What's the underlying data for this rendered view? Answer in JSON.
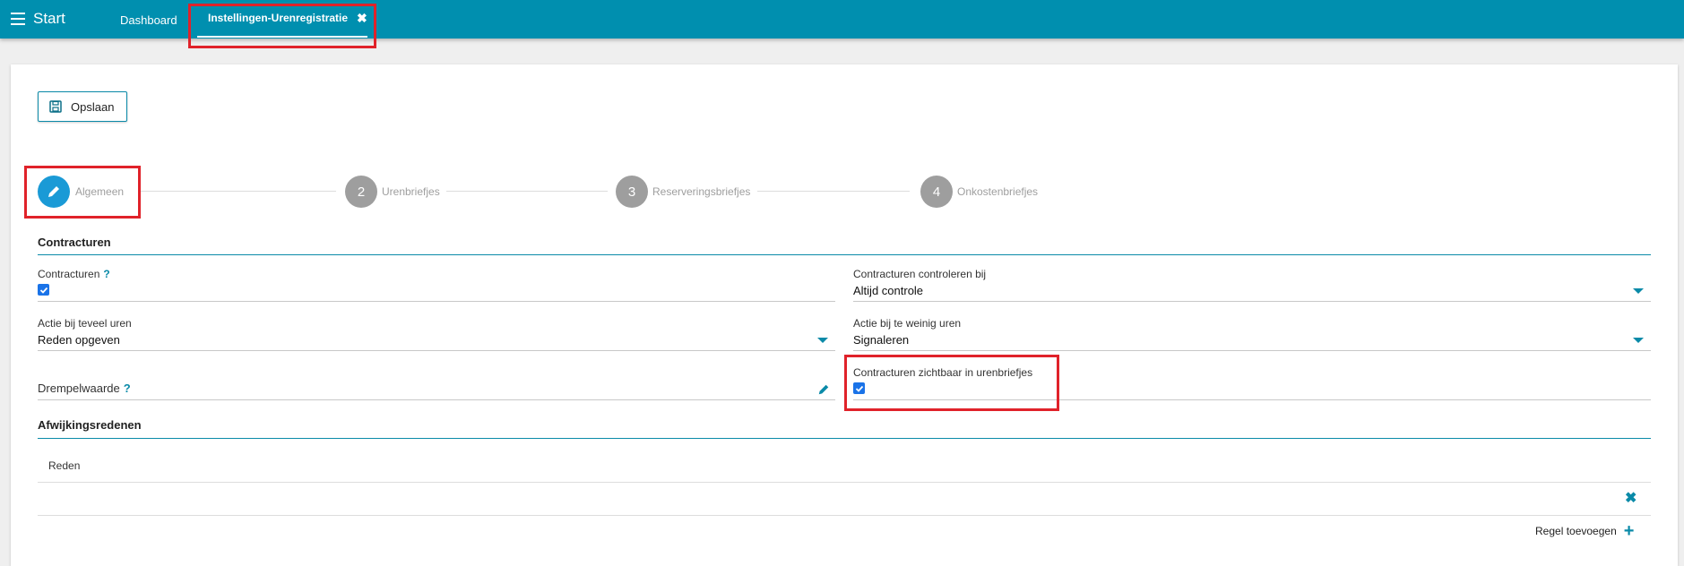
{
  "header": {
    "app_title": "Start",
    "nav_dashboard": "Dashboard",
    "active_tab": "Instellingen-Urenregistratie",
    "close_glyph": "✖"
  },
  "toolbar": {
    "save_label": "Opslaan",
    "save_icon": "floppy-disk-icon"
  },
  "steps": [
    {
      "number": "",
      "label": "Algemeen",
      "icon": "pencil-icon",
      "active": true
    },
    {
      "number": "2",
      "label": "Urenbriefjes",
      "active": false
    },
    {
      "number": "3",
      "label": "Reserveringsbriefjes",
      "active": false
    },
    {
      "number": "4",
      "label": "Onkostenbriefjes",
      "active": false
    }
  ],
  "contracturen": {
    "section_title": "Contracturen",
    "contracturen_label": "Contracturen",
    "help_glyph": "?",
    "contracturen_checked": true,
    "controleren_label": "Contracturen controleren bij",
    "controleren_value": "Altijd controle",
    "teveel_label": "Actie bij teveel uren",
    "teveel_value": "Reden opgeven",
    "teweinig_label": "Actie bij te weinig uren",
    "teweinig_value": "Signaleren",
    "drempel_label": "Drempelwaarde",
    "zichtbaar_label": "Contracturen zichtbaar in urenbriefjes",
    "zichtbaar_checked": true
  },
  "afwijkingsredenen": {
    "section_title": "Afwijkingsredenen",
    "column_reden": "Reden",
    "delete_glyph": "✖",
    "add_row_label": "Regel toevoegen",
    "add_glyph": "+"
  },
  "colors": {
    "topbar": "#008faf",
    "accent": "#0a8aa8",
    "step_active": "#1a9ad6",
    "step_inactive": "#9e9e9e",
    "highlight": "#e0222a"
  }
}
